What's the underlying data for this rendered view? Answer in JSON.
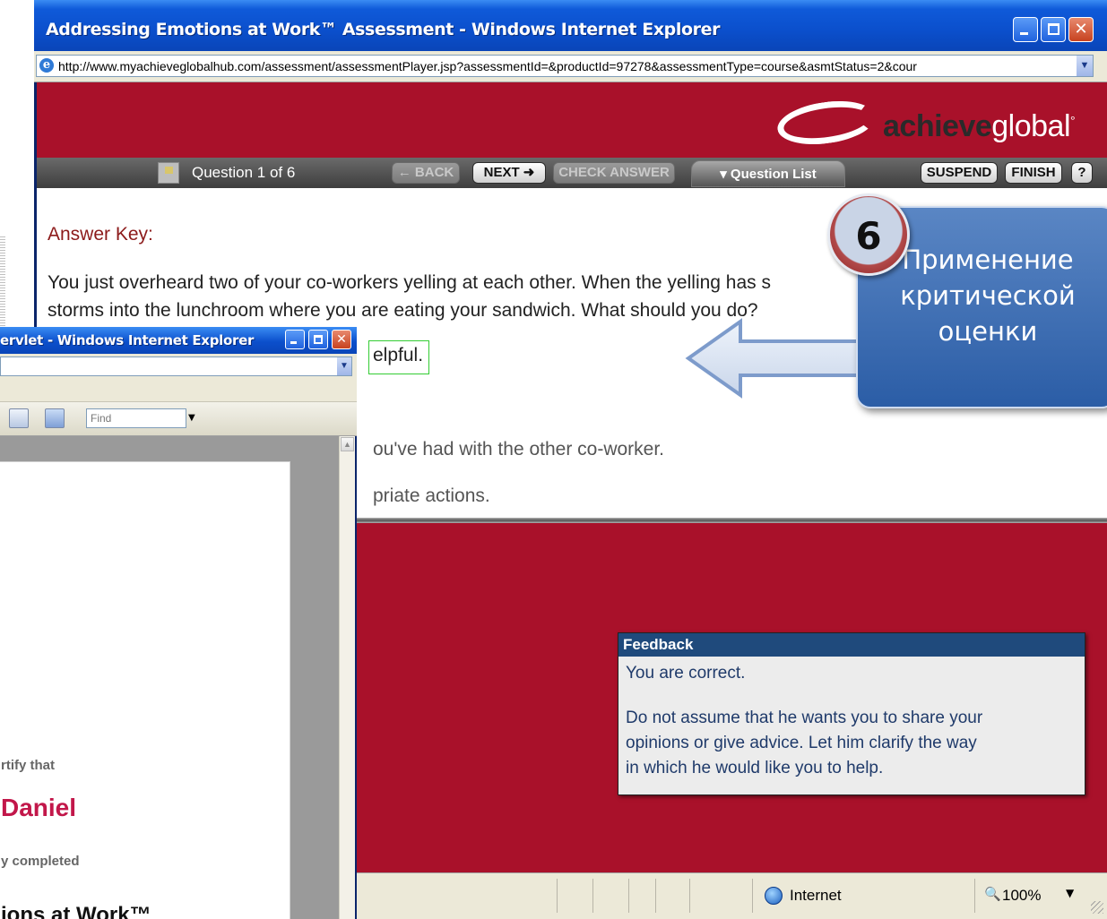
{
  "main_window": {
    "title": "Addressing Emotions at Work™ Assessment - Windows Internet Explorer",
    "address": "http://www.myachieveglobalhub.com/assessment/assessmentPlayer.jsp?assessmentId=&productId=97278&assessmentType=course&asmtStatus=2&cour"
  },
  "brand": {
    "bold": "achieve",
    "light": "global",
    "mark": "°"
  },
  "nav": {
    "counter": "Question 1 of 6",
    "back": "← BACK",
    "next": "NEXT ➜",
    "check": "CHECK ANSWER",
    "question_list": "▾ Question List",
    "suspend": "SUSPEND",
    "finish": "FINISH",
    "help": "?"
  },
  "question": {
    "heading": "Answer Key:",
    "line1": "You just overheard two of your co-workers yelling at each other. When the yelling has s",
    "line2": "storms into the lunchroom where you are eating your sandwich. What should you do?",
    "option_selected": "elpful.",
    "option_b": "ou've had with the other co-worker.",
    "option_c": "priate actions."
  },
  "feedback": {
    "title": "Feedback",
    "line1": "You are correct.",
    "line2": "Do not assume that he wants you to share your",
    "line3": "opinions or give advice. Let him clarify the way",
    "line4": "in which he would like you to help."
  },
  "status": {
    "zone": "Internet",
    "zoom": "100%"
  },
  "callout": {
    "number": "6",
    "line1": "Применение",
    "line2": "критической",
    "line3": "оценки"
  },
  "cert_window": {
    "title": "ervlet - Windows Internet Explorer",
    "find_placeholder": "Find",
    "certify": "rtify that",
    "name": "Daniel",
    "completed": "y completed",
    "course": "ions at Work™"
  },
  "colors": {
    "brand_red": "#a9112a",
    "xp_blue": "#0b4fcc",
    "feedback_header": "#1f4a7c",
    "callout_blue": "#3a6db5"
  }
}
